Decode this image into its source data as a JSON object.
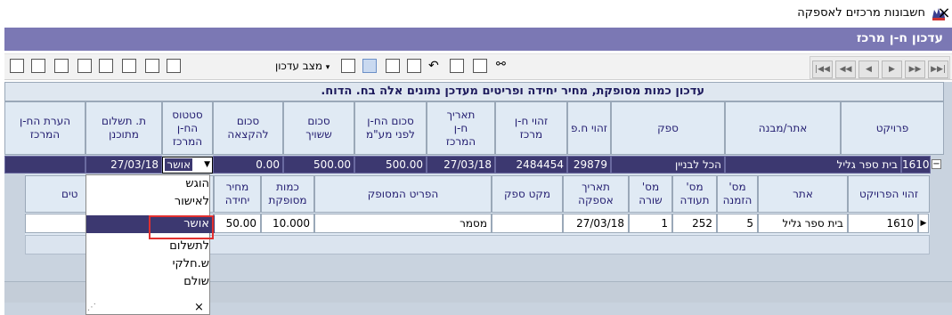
{
  "window": {
    "title": "חשבונות מרכזים לאספקה",
    "close_glyph": "×",
    "app_icon": "app-crown-icon"
  },
  "band_title": "עדכון ח-ן מרכז",
  "toolbar": {
    "edit_state_label": "מצב עדכון",
    "icons": [
      "print-icon",
      "print-preview-icon",
      "report-icon",
      "export-icon",
      "new-document-icon",
      "list-icon",
      "layout-icon",
      "grid-icon",
      "clipboard-icon",
      "select-icon",
      "next-doc-icon",
      "save-icon",
      "undo-icon",
      "edit-icon",
      "refresh-icon",
      "binoculars-icon"
    ],
    "nav": [
      "|◀◀",
      "◀◀",
      "◀",
      "▶",
      "▶▶",
      "▶▶|"
    ]
  },
  "banner_text": "עדכון כמות מסופקת, מחיר יחידה ופריטים מעדכן נתונים אלה בח. הדוח.",
  "main_grid": {
    "headers": [
      "פרויקט",
      "אתר/מבנה",
      "ספק",
      "זהוי ח.פ",
      "זהוי ח-ן מרכז",
      "תאריך ח-ן המרכז",
      "סכום הח-ן לפני מע\"מ",
      "סכום ששויך",
      "סכום להקצאה",
      "סטטוס הח-ן המרכז",
      "ת. תשלום מתוכנן",
      "הערת הח-ן המרכז"
    ],
    "row": {
      "project": "1610",
      "project_name": "בית ספר גליל",
      "site": "הכל לבניין",
      "supplier_id": "29879",
      "center_id": "2484454",
      "center_date": "27/03/18",
      "amount_before_vat": "500.00",
      "amount_assigned": "500.00",
      "amount_to_allocate": "0.00",
      "status": "אושר",
      "planned_payment_date": "27/03/18",
      "note": ""
    },
    "expander": "−"
  },
  "inner_grid": {
    "headers": [
      "זהוי הפרויקט",
      "אתר",
      "מס' הזמנה",
      "מס' תעודה",
      "מס' שורה",
      "תאריך אספקה",
      "מקט ספק",
      "הפריט המסופק",
      "כמות מסופקת",
      "מחיר יחידה",
      "טים"
    ],
    "row": {
      "project_id": "1610",
      "site": "בית ספר גליל",
      "order_no": "5",
      "cert_no": "252",
      "line_no": "1",
      "supply_date": "27/03/18",
      "supplier_sku": "",
      "item": "מסמר",
      "qty": "10.000",
      "unit_price": "50.00"
    },
    "row_indicator": "▶"
  },
  "status_dropdown": {
    "options": [
      "הוגש",
      "לאישור",
      "אושר",
      "לתשלום",
      "ש.חלקי",
      "שולם"
    ],
    "selected_index": 2,
    "close_glyph": "×",
    "arrow": "▼"
  },
  "colors": {
    "band": "#7b78b4",
    "selected_row": "#3c3870",
    "header_bg": "#e0eaf4",
    "highlight_box": "#e23030"
  }
}
